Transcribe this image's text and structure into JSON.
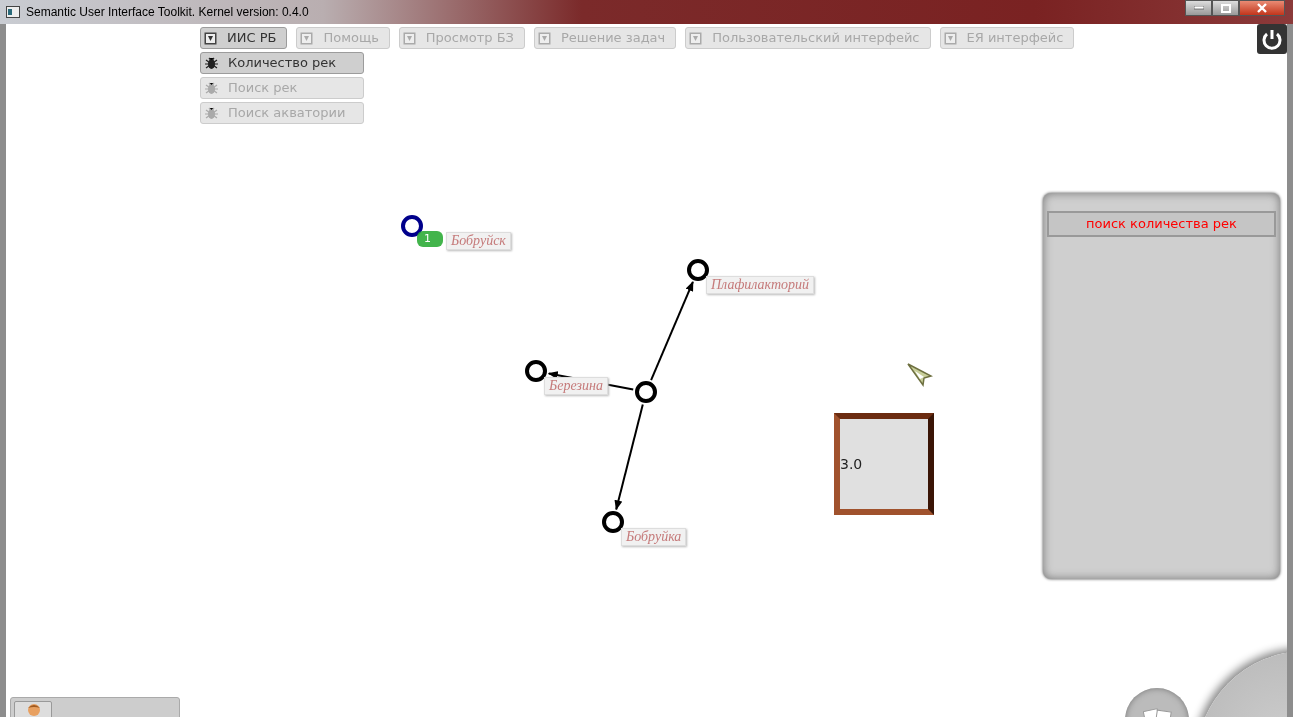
{
  "window": {
    "title": "Semantic User Interface Toolkit. Kernel version: 0.4.0"
  },
  "menu": [
    {
      "label": "ИИС РБ",
      "selected": true
    },
    {
      "label": "Помощь",
      "selected": false
    },
    {
      "label": "Просмотр БЗ",
      "selected": false
    },
    {
      "label": "Решение задач",
      "selected": false
    },
    {
      "label": "Пользовательский интерфейс",
      "selected": false
    },
    {
      "label": "ЕЯ интерфейс",
      "selected": false
    }
  ],
  "submenu": [
    {
      "label": "Количество рек",
      "disabled": false
    },
    {
      "label": "Поиск рек",
      "disabled": true
    },
    {
      "label": "Поиск акватории",
      "disabled": true
    }
  ],
  "graph": {
    "nodes": [
      {
        "label": "Бобруйск",
        "selected": true,
        "badge": "1"
      },
      {
        "selected": false,
        "children": [
          {
            "label": "Плафилакторий",
            "selected": false
          },
          {
            "label": "Березина",
            "selected": false
          },
          {
            "label": "Бобруйка",
            "selected": false
          }
        ]
      }
    ]
  },
  "value_box": {
    "value": "3.0"
  },
  "side_panel": {
    "title": "поиск количества рек"
  }
}
